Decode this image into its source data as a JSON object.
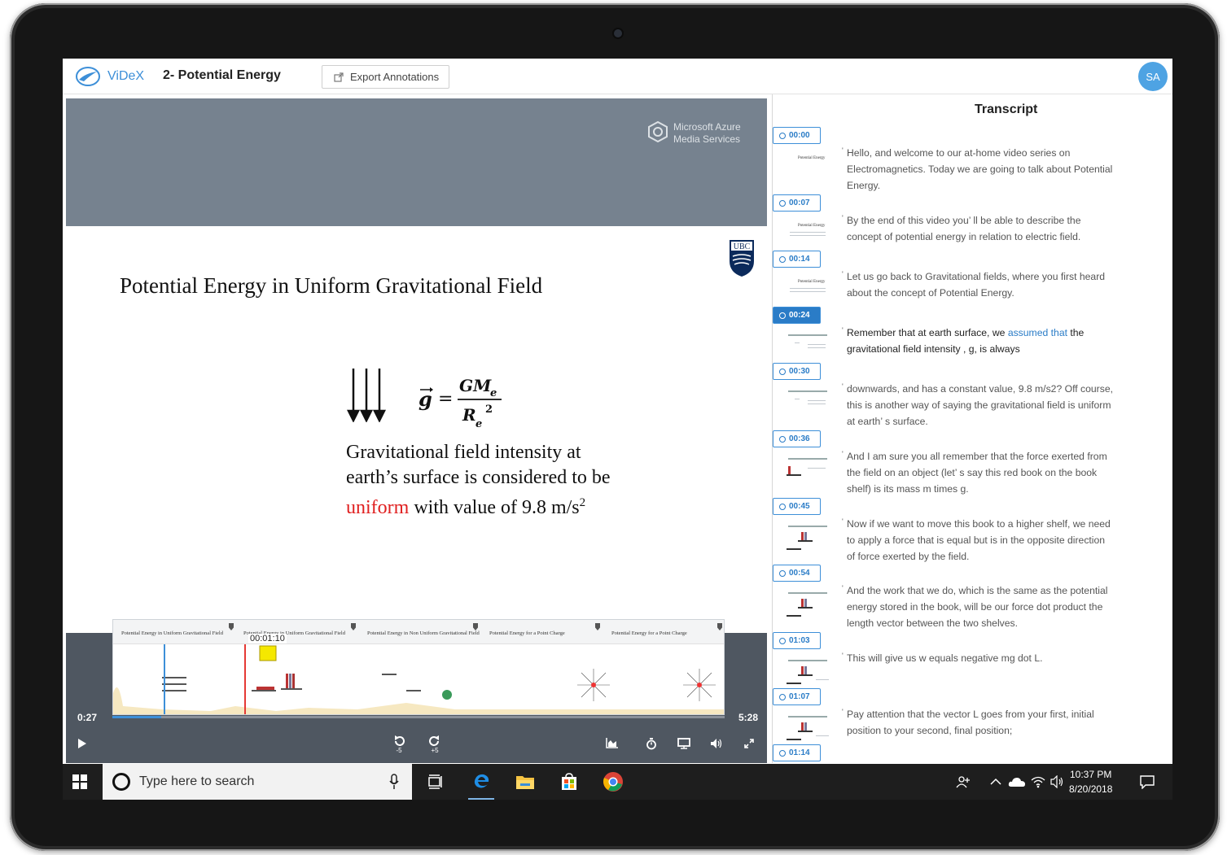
{
  "header": {
    "brand": "ViDeX",
    "video_title": "2- Potential Energy",
    "export_label": "Export Annotations",
    "avatar_initials": "SA"
  },
  "player": {
    "watermark_line1": "Microsoft Azure",
    "watermark_line2": "Media Services",
    "ubc_badge": "UBC",
    "slide_title": "Potential Energy in Uniform Gravitational Field",
    "formula_lhs": "g",
    "formula_eq": "=",
    "formula_numerator": "GM",
    "formula_numerator_sub": "e",
    "formula_denominator": "R",
    "formula_denominator_sub": "e",
    "formula_denominator_sup": "2",
    "body_line1": "Gravitational field intensity at",
    "body_line2": "earth’s surface is considered to be",
    "body_line3_red": "uniform",
    "body_line3_rest": " with value of 9.8 m/s",
    "body_line3_sup": "2",
    "current_time": "0:27",
    "duration": "5:28",
    "progress_fraction": 0.08,
    "annotation_time": "00:01:10",
    "rewind_label": "-5",
    "forward_label": "+5",
    "thumbnails": [
      "Potential Energy in Uniform Gravitational Field",
      "Potential Energy in Uniform Gravitational Field",
      "Potential Energy in Non Uniform Gravitational Field",
      "Potential Energy for a Point Charge",
      "Potential Energy for a Point Charge"
    ]
  },
  "transcript": {
    "title": "Transcript",
    "entries": [
      {
        "time": "00:00",
        "thumb_caption": "Potential Energy",
        "text": "Hello, and welcome to our at-home video series on Electromagnetics. Today we are going to talk about Potential Energy."
      },
      {
        "time": "00:07",
        "thumb_caption": "Potential Energy",
        "text": "By the end of this video you’ ll be able to describe the concept of potential energy in relation to electric field."
      },
      {
        "time": "00:14",
        "thumb_caption": "Potential Energy",
        "text": "Let us go back to Gravitational fields, where you first heard about the concept of Potential Energy."
      },
      {
        "time": "00:24",
        "active": true,
        "text_pre": "Remember that at earth surface, we ",
        "text_highlight": "assumed that",
        "text_post": " the gravitational field intensity , g, is always"
      },
      {
        "time": "00:30",
        "text": "downwards, and has a constant value, 9.8 m/s2? Off course, this is another way of saying the gravitational field is uniform at earth’ s surface."
      },
      {
        "time": "00:36",
        "text": "And I am sure you all remember that the force exerted from the field on an object (let’ s say this red book on the book shelf) is its mass m times g."
      },
      {
        "time": "00:45",
        "text": "Now if we want to move this book to a higher shelf, we need to apply a force that is equal but is in the opposite direction of force exerted by the field."
      },
      {
        "time": "00:54",
        "text": "And the work that we do, which is the same as the potential energy stored in the book, will be our force dot product the length vector between the two shelves."
      },
      {
        "time": "01:03",
        "text": "This will give us w equals negative mg dot L."
      },
      {
        "time": "01:07",
        "text": "Pay attention that the vector L goes from your first, initial position to your second, final position;"
      },
      {
        "time": "01:14",
        "text": ""
      }
    ]
  },
  "taskbar": {
    "search_placeholder": "Type here to search",
    "time": "10:37 PM",
    "date": "8/20/2018"
  },
  "colors": {
    "accent": "#3d8fd8",
    "video_band": "#76828f",
    "controls": "#4f5761",
    "red_text": "#e02020"
  }
}
